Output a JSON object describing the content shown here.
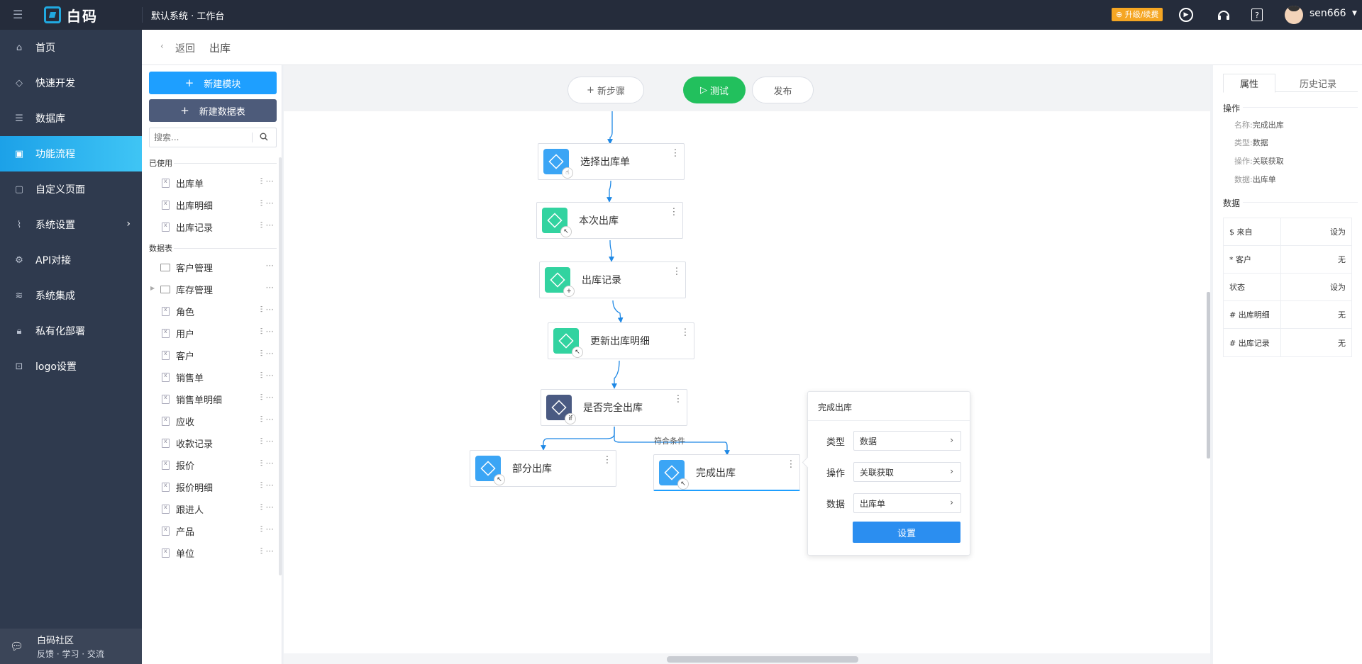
{
  "topbar": {
    "logo_text": "白码",
    "system_title": "默认系统 · 工作台",
    "upgrade_label": "升级/续费",
    "username": "sen666"
  },
  "sidebar": {
    "items": [
      {
        "label": "首页",
        "icon": "home-icon"
      },
      {
        "label": "快速开发",
        "icon": "cube-icon"
      },
      {
        "label": "数据库",
        "icon": "database-icon"
      },
      {
        "label": "功能流程",
        "icon": "flow-icon",
        "active": true
      },
      {
        "label": "自定义页面",
        "icon": "page-icon"
      },
      {
        "label": "系统设置",
        "icon": "settings-chart-icon",
        "has_submenu": true
      },
      {
        "label": "API对接",
        "icon": "api-icon"
      },
      {
        "label": "系统集成",
        "icon": "layers-icon"
      },
      {
        "label": "私有化部署",
        "icon": "lock-icon"
      },
      {
        "label": "logo设置",
        "icon": "logo-icon"
      }
    ],
    "community": {
      "title": "白码社区",
      "subtitle": "反馈 · 学习 · 交流"
    }
  },
  "header": {
    "back_label": "返回",
    "page_title": "出库"
  },
  "left_panel": {
    "new_module_label": "新建模块",
    "new_table_label": "新建数据表",
    "search_placeholder": "搜索...",
    "used_section_label": "已使用",
    "used_items": [
      "出库单",
      "出库明细",
      "出库记录"
    ],
    "tables_section_label": "数据表",
    "folders": [
      "客户管理",
      "库存管理"
    ],
    "tables": [
      "角色",
      "用户",
      "客户",
      "销售单",
      "销售单明细",
      "应收",
      "收款记录",
      "报价",
      "报价明细",
      "跟进人",
      "产品",
      "单位"
    ]
  },
  "canvas": {
    "new_step_label": "新步骤",
    "test_label": "测试",
    "publish_label": "发布",
    "nodes": [
      {
        "label": "选择出库单",
        "color": "#3ba5f5",
        "badge": "cursor"
      },
      {
        "label": "本次出库",
        "color": "#32d3a0",
        "badge": "arrow"
      },
      {
        "label": "出库记录",
        "color": "#32d3a0",
        "badge": "plus"
      },
      {
        "label": "更新出库明细",
        "color": "#32d3a0",
        "badge": "arrow"
      },
      {
        "label": "是否完全出库",
        "color": "#4a5a82",
        "badge": "if"
      },
      {
        "label": "部分出库",
        "color": "#3ba5f5",
        "badge": "arrow"
      },
      {
        "label": "完成出库",
        "color": "#3ba5f5",
        "badge": "arrow"
      }
    ],
    "edge_label": "符合条件"
  },
  "popup": {
    "title": "完成出库",
    "type_label": "类型",
    "type_value": "数据",
    "op_label": "操作",
    "op_value": "关联获取",
    "data_label": "数据",
    "data_value": "出库单",
    "setup_label": "设置"
  },
  "right_panel": {
    "tab_props": "属性",
    "tab_history": "历史记录",
    "op_section": "操作",
    "props": [
      {
        "key": "名称:",
        "value": "完成出库"
      },
      {
        "key": "类型:",
        "value": "数据"
      },
      {
        "key": "操作:",
        "value": "关联获取"
      },
      {
        "key": "数据:",
        "value": "出库单"
      }
    ],
    "data_section": "数据",
    "data_rows": [
      {
        "key": "$ 来自",
        "value": "设为"
      },
      {
        "key": "* 客户",
        "value": "无"
      },
      {
        "key": "状态",
        "value": "设为"
      },
      {
        "key": "# 出库明细",
        "value": "无"
      },
      {
        "key": "# 出库记录",
        "value": "无"
      }
    ]
  },
  "colors": {
    "accent": "#1e9fff",
    "test_green": "#22c05d",
    "sidebar_bg": "#2f3a4e",
    "topbar_bg": "#252c3b"
  }
}
